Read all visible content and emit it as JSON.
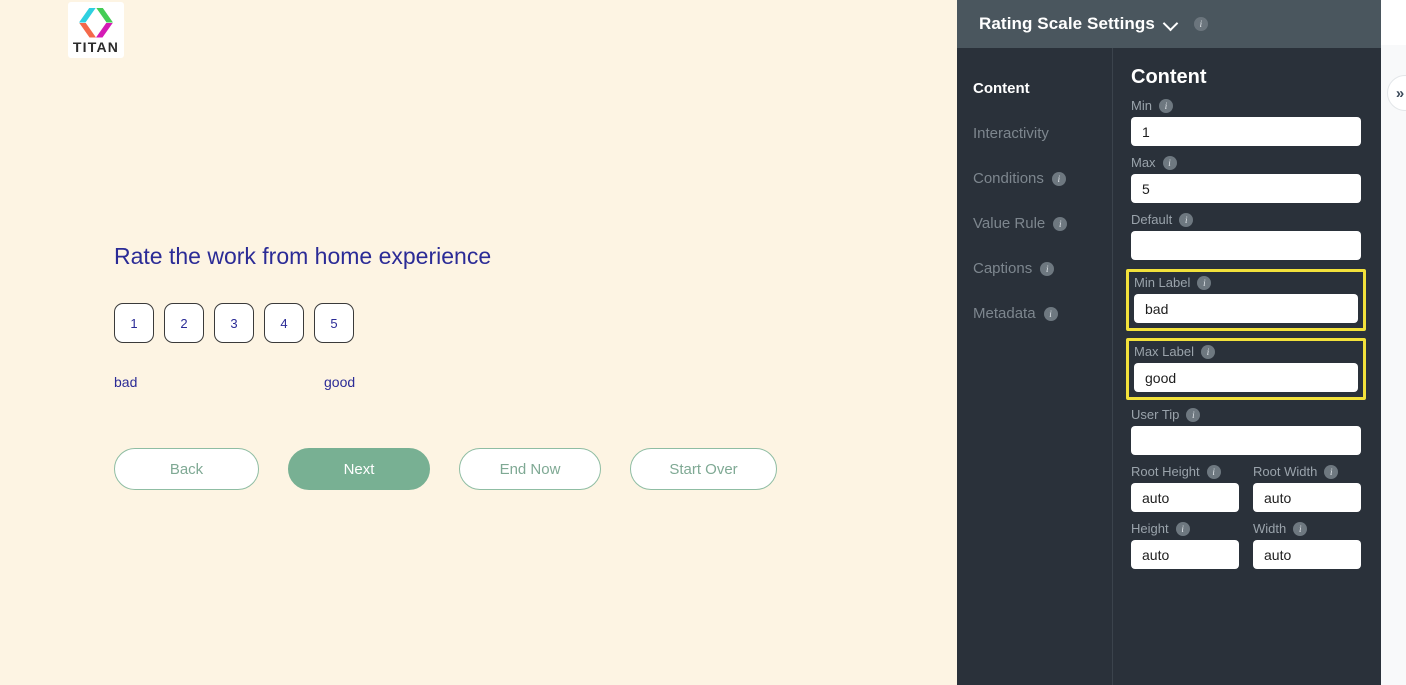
{
  "form_preview": {
    "brand": {
      "wordmark": "TITAN",
      "logo_icon": "titan-diamond-logo"
    },
    "question_title": "Rate the work from home experience",
    "rating_options": [
      "1",
      "2",
      "3",
      "4",
      "5"
    ],
    "min_caption": "bad",
    "max_caption": "good",
    "nav_buttons": [
      {
        "label": "Back",
        "primary": false
      },
      {
        "label": "Next",
        "primary": true
      },
      {
        "label": "End Now",
        "primary": false
      },
      {
        "label": "Start Over",
        "primary": false
      }
    ],
    "colors": {
      "background": "#fdf4e3",
      "title_text": "#2b2b96",
      "primary_button": "#78b093"
    }
  },
  "settings_panel": {
    "header": {
      "title": "Rating Scale Settings",
      "chevron_icon": "chevron-down-icon",
      "info_icon": "info-icon"
    },
    "section_nav": [
      {
        "label": "Content",
        "active": true,
        "has_info": false
      },
      {
        "label": "Interactivity",
        "active": false,
        "has_info": false
      },
      {
        "label": "Conditions",
        "active": false,
        "has_info": true
      },
      {
        "label": "Value Rule",
        "active": false,
        "has_info": true
      },
      {
        "label": "Captions",
        "active": false,
        "has_info": true
      },
      {
        "label": "Metadata",
        "active": false,
        "has_info": true
      }
    ],
    "content": {
      "heading": "Content",
      "fields": {
        "min": {
          "label": "Min",
          "value": "1"
        },
        "max": {
          "label": "Max",
          "value": "5"
        },
        "default": {
          "label": "Default",
          "value": ""
        },
        "min_label": {
          "label": "Min Label",
          "value": "bad",
          "highlighted": true
        },
        "max_label": {
          "label": "Max Label",
          "value": "good",
          "highlighted": true
        },
        "user_tip": {
          "label": "User Tip",
          "value": ""
        },
        "root_height": {
          "label": "Root Height",
          "value": "auto"
        },
        "root_width": {
          "label": "Root Width",
          "value": "auto"
        },
        "height": {
          "label": "Height",
          "value": "auto"
        },
        "width": {
          "label": "Width",
          "value": "auto"
        }
      }
    },
    "highlight_color": "#f2e13b"
  },
  "right_edge": {
    "collapse_icon": "chevron-right-icon"
  }
}
